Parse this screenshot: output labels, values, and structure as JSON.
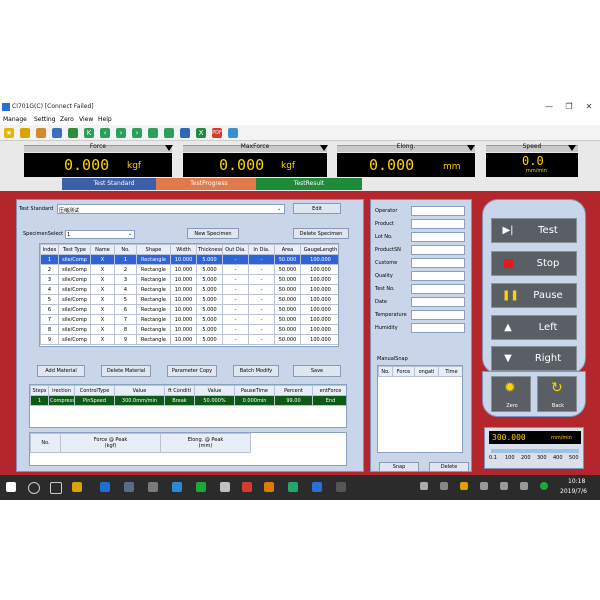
{
  "window": {
    "title": "CI701G(C)  [Connect Failed]",
    "controls": [
      "—",
      "❐",
      "✕"
    ]
  },
  "menu": [
    "Manage",
    "Setting",
    "Zero",
    "View",
    "Help"
  ],
  "readouts": [
    {
      "label": "Force",
      "value": "0.000",
      "unit": "kgf"
    },
    {
      "label": "MaxForce",
      "value": "0.000",
      "unit": "kgf"
    },
    {
      "label": "Elong.",
      "value": "0.000",
      "unit": "mm"
    },
    {
      "label": "Speed",
      "value": "0.0",
      "unit": "mm/min"
    }
  ],
  "tabs": [
    "Test Standard",
    "TestProgress",
    "TestResult"
  ],
  "test_standard": {
    "label": "Test Standard",
    "value": "压缩测试",
    "edit_label": "Edit",
    "specimen_select_label": "SpecimenSelect",
    "specimen_select_value": "1",
    "new_specimen_label": "New Specimen",
    "delete_specimen_label": "Delete Specimen"
  },
  "specimen_table": {
    "columns": [
      "Index",
      "Test Type",
      "Name",
      "No.",
      "Shape",
      "Width",
      "Thickness",
      "Out Dia.",
      "In Dia.",
      "Area",
      "GaugeLength"
    ],
    "rows": [
      [
        "1",
        "sile/Comp",
        "X",
        "1",
        "Rectangle",
        "10.000",
        "5.000",
        "-",
        "-",
        "50.000",
        "100.000"
      ],
      [
        "2",
        "sile/Comp",
        "X",
        "2",
        "Rectangle",
        "10.000",
        "5.000",
        "-",
        "-",
        "50.000",
        "100.000"
      ],
      [
        "3",
        "sile/Comp",
        "X",
        "3",
        "Rectangle",
        "10.000",
        "5.000",
        "-",
        "-",
        "50.000",
        "100.000"
      ],
      [
        "4",
        "sile/Comp",
        "X",
        "4",
        "Rectangle",
        "10.000",
        "5.000",
        "-",
        "-",
        "50.000",
        "100.000"
      ],
      [
        "5",
        "sile/Comp",
        "X",
        "5",
        "Rectangle",
        "10.000",
        "5.000",
        "-",
        "-",
        "50.000",
        "100.000"
      ],
      [
        "6",
        "sile/Comp",
        "X",
        "6",
        "Rectangle",
        "10.000",
        "5.000",
        "-",
        "-",
        "50.000",
        "100.000"
      ],
      [
        "7",
        "sile/Comp",
        "X",
        "7",
        "Rectangle",
        "10.000",
        "5.000",
        "-",
        "-",
        "50.000",
        "100.000"
      ],
      [
        "8",
        "sile/Comp",
        "X",
        "8",
        "Rectangle",
        "10.000",
        "5.000",
        "-",
        "-",
        "50.000",
        "100.000"
      ],
      [
        "9",
        "sile/Comp",
        "X",
        "9",
        "Rectangle",
        "10.000",
        "5.000",
        "-",
        "-",
        "50.000",
        "100.000"
      ]
    ]
  },
  "actions": [
    "Add Material",
    "Delete Material",
    "Parameter Copy",
    "Batch Modify",
    "Save"
  ],
  "steps_table": {
    "columns": [
      "Steps",
      "irection",
      "ControlType",
      "Value",
      "ft Conditi",
      "Value",
      "PauseTime",
      "Percent",
      "entForce"
    ],
    "rows": [
      [
        "1",
        "Compress",
        "PinSpeed",
        "300.0mm/min",
        "Break",
        "50.000%",
        "0.000min",
        "99.00",
        "End"
      ]
    ]
  },
  "result_table": {
    "columns": [
      "No.",
      "Force @ Peak\n(kgf)",
      "Elong. @ Peak\n(mm)"
    ]
  },
  "info_fields": [
    "Operator",
    "Product",
    "Lot No.",
    "ProductSN",
    "Custome",
    "Quality",
    "Test No.",
    "Date",
    "Temperature",
    "Humidity"
  ],
  "manual_snap": {
    "title": "ManualSnap",
    "columns": [
      "No.",
      "Force",
      "ongati",
      "Time"
    ],
    "snap_label": "Snap",
    "delete_label": "Delete"
  },
  "control_buttons": [
    {
      "label": "Test",
      "icon": "play-step-icon"
    },
    {
      "label": "Stop",
      "icon": "stop-icon"
    },
    {
      "label": "Pause",
      "icon": "pause-icon"
    },
    {
      "label": "Left",
      "icon": "up-icon"
    },
    {
      "label": "Right",
      "icon": "down-icon"
    }
  ],
  "aux_buttons": [
    {
      "label": "Zero",
      "icon": "sun-icon"
    },
    {
      "label": "Back",
      "icon": "return-icon"
    }
  ],
  "speed_control": {
    "value": "300.000",
    "unit": "mm/min",
    "scale": [
      "0.1",
      "100",
      "200",
      "300",
      "400",
      "500"
    ]
  },
  "taskbar": {
    "time": "10:18",
    "date": "2019/7/6"
  },
  "colors": {
    "main_bg": "#b3262b",
    "readout_digits": "#ffd200",
    "tab_standard": "#3c5fa8",
    "tab_progress": "#e07a4c",
    "tab_result": "#1f8a3a",
    "selected_row": "#2f64d8",
    "step_row": "#0c5a16"
  }
}
